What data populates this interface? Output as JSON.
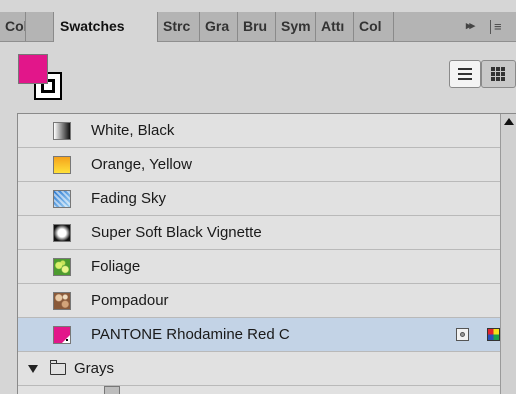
{
  "tabs": [
    {
      "label": "Col",
      "active": false
    },
    {
      "label": "Swatches",
      "active": true
    },
    {
      "label": "Strc",
      "active": false
    },
    {
      "label": "Gra",
      "active": false
    },
    {
      "label": "Bru",
      "active": false
    },
    {
      "label": "Sym",
      "active": false
    },
    {
      "label": "Attı",
      "active": false
    },
    {
      "label": "Col",
      "active": false
    }
  ],
  "tab_overflow": "▸▸",
  "tab_menu": "≡",
  "fill_color": "#e2168a",
  "stroke_color": "#000000",
  "view_buttons": {
    "list": "list-view-icon",
    "grid": "grid-view-icon"
  },
  "swatches": [
    {
      "label": "White, Black",
      "icon": "gradient-icon"
    },
    {
      "label": "Orange, Yellow",
      "icon": "gradient-icon"
    },
    {
      "label": "Fading Sky",
      "icon": "pattern-icon"
    },
    {
      "label": "Super Soft Black Vignette",
      "icon": "gradient-icon"
    },
    {
      "label": "Foliage",
      "icon": "pattern-icon"
    },
    {
      "label": "Pompadour",
      "icon": "pattern-icon"
    },
    {
      "label": "PANTONE Rhodamine Red C",
      "icon": "spot-color-icon",
      "selected": true,
      "color": "#e2168a"
    }
  ],
  "group": {
    "label": "Grays",
    "expanded": true
  },
  "selection_color": "#c3d3e6"
}
